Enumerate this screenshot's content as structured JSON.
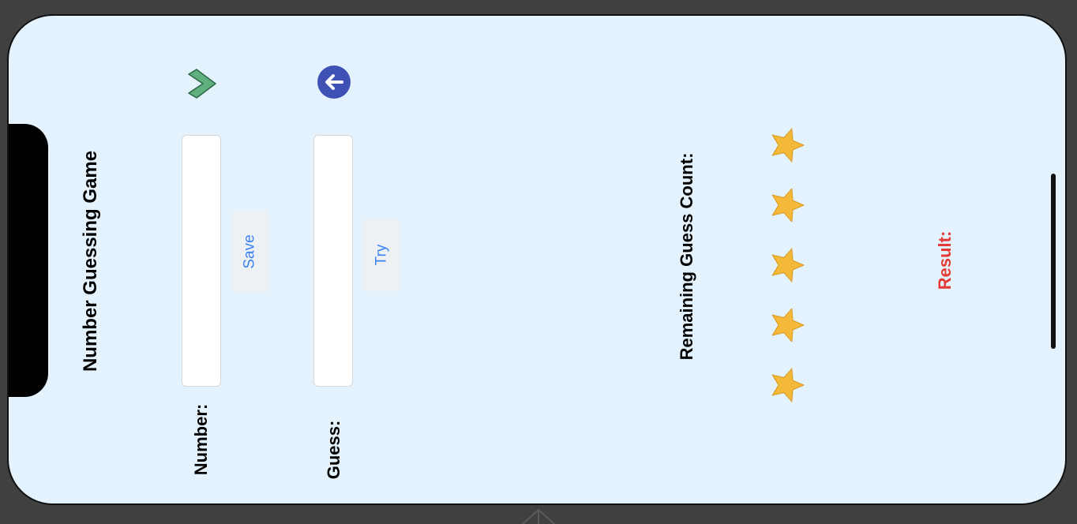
{
  "app": {
    "title": "Number Guessing Game"
  },
  "number_row": {
    "label": "Number:",
    "input_value": "",
    "save_button": "Save",
    "icon": "chevron-right-icon"
  },
  "guess_row": {
    "label": "Guess:",
    "input_value": "",
    "try_button": "Try",
    "icon": "back-arrow-icon"
  },
  "remaining": {
    "label": "Remaining Guess Count:",
    "stars_shown": 5,
    "icon": "star-icon"
  },
  "result": {
    "label": "Result:"
  },
  "colors": {
    "background": "#e3f2fd",
    "button_text": "#3b82f6",
    "result_text": "#e53935",
    "back_icon": "#3f51b5",
    "chevron_icon": "#5fb07e",
    "star": "#f4b93a"
  }
}
